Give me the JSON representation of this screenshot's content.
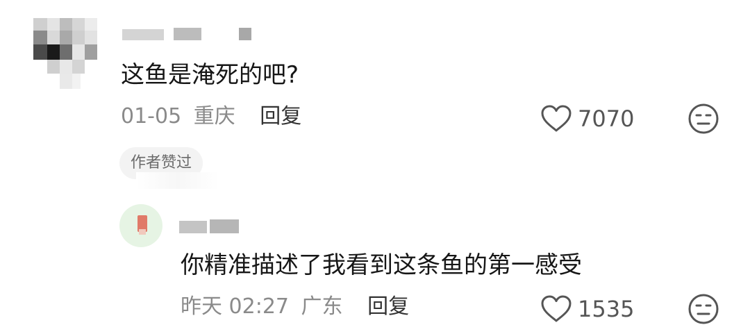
{
  "comments": [
    {
      "text": "这鱼是淹死的吧?",
      "date": "01-05",
      "location": "重庆",
      "reply_label": "回复",
      "like_count": "7070",
      "like_icon": "heart-outline-icon",
      "dislike_icon": "meh-face-icon",
      "author_tag": "作者赞过",
      "replies": [
        {
          "text": "你精准描述了我看到这条鱼的第一感受",
          "date": "昨天 02:27",
          "location": "广东",
          "reply_label": "回复",
          "like_count": "1535",
          "like_icon": "heart-outline-icon",
          "dislike_icon": "meh-face-icon"
        }
      ]
    }
  ],
  "colors": {
    "text": "#161616",
    "meta": "#8a8a8a",
    "reply": "#333333",
    "tag_bg": "#f3f3f3",
    "icon": "#555555"
  }
}
